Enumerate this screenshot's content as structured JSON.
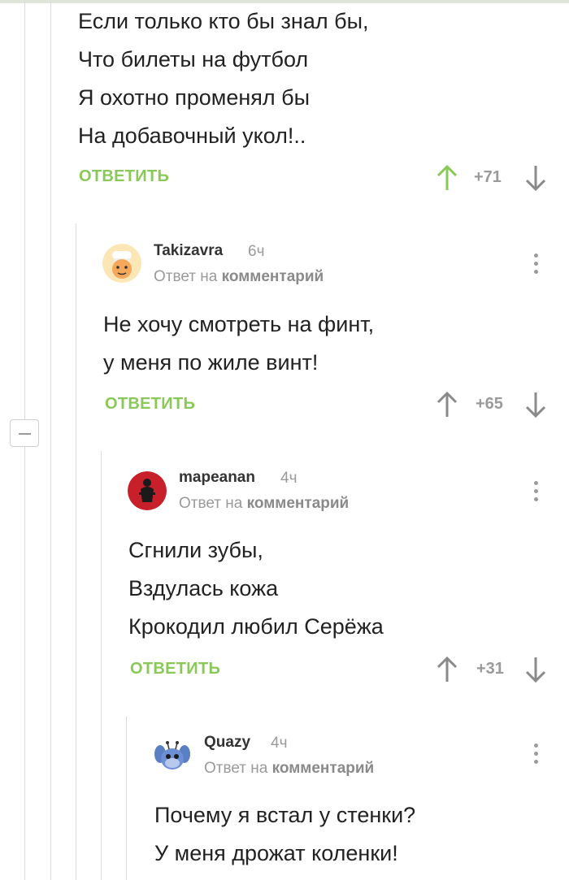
{
  "root_comment": {
    "lines": [
      "Если только кто бы знал бы,",
      "Что билеты на футбол",
      "Я охотно променял бы",
      "На добавочный укол!.."
    ],
    "reply_label": "ОТВЕТИТЬ",
    "score": "+71",
    "upvote_color": "#8ac858"
  },
  "replies": [
    {
      "author": "Takizavra",
      "time": "6ч",
      "reply_to_prefix": "Ответ на",
      "reply_to_link": "комментарий",
      "lines": [
        "Не хочу смотреть на финт,",
        "у меня по жиле винт!"
      ],
      "reply_label": "ОТВЕТИТЬ",
      "score": "+65"
    },
    {
      "author": "mapeanan",
      "time": "4ч",
      "reply_to_prefix": "Ответ на",
      "reply_to_link": "комментарий",
      "lines": [
        "Сгнили зубы,",
        "Вздулась кожа",
        "Крокодил любил Серёжа"
      ],
      "reply_label": "ОТВЕТИТЬ",
      "score": "+31"
    },
    {
      "author": "Quazy",
      "time": "4ч",
      "reply_to_prefix": "Ответ на",
      "reply_to_link": "комментарий",
      "lines": [
        "Почему я встал у стенки?",
        "У меня дрожат коленки!"
      ]
    }
  ],
  "icons": {
    "upvote": "arrow-up-icon",
    "downvote": "arrow-down-icon",
    "menu": "kebab-menu-icon",
    "collapse": "collapse-minus-icon"
  },
  "colors": {
    "accent_green": "#8ac858",
    "muted_gray": "#9a9a9a",
    "thread_line": "#dcdcdc"
  }
}
